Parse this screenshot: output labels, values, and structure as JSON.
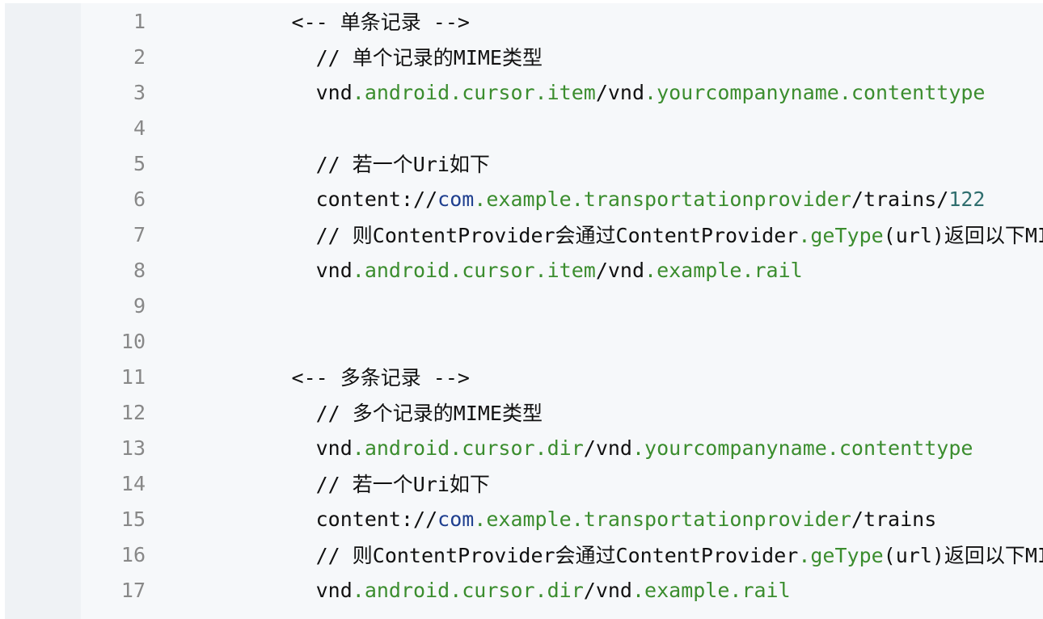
{
  "colors": {
    "background": "#f6f8fa",
    "gutter": "#eff2f5",
    "line_number": "#888888",
    "plain": "#111111",
    "property": "#3b8d2e",
    "keyword": "#1f3f8f",
    "number": "#2f6e6e"
  },
  "lines": [
    {
      "n": "1",
      "tokens": [
        {
          "t": "<-- 单条记录 -->",
          "c": "p"
        }
      ]
    },
    {
      "n": "2",
      "tokens": [
        {
          "t": "  // 单个记录的MIME类型",
          "c": "p"
        }
      ]
    },
    {
      "n": "3",
      "tokens": [
        {
          "t": "  vnd",
          "c": "p"
        },
        {
          "t": ".android.cursor.item",
          "c": "g"
        },
        {
          "t": "/vnd",
          "c": "p"
        },
        {
          "t": ".yourcompanyname.contenttype",
          "c": "g"
        }
      ]
    },
    {
      "n": "4",
      "tokens": []
    },
    {
      "n": "5",
      "tokens": [
        {
          "t": "  // 若一个Uri如下",
          "c": "p"
        }
      ]
    },
    {
      "n": "6",
      "tokens": [
        {
          "t": "  content://",
          "c": "p"
        },
        {
          "t": "com",
          "c": "b"
        },
        {
          "t": ".example.transportationprovider",
          "c": "g"
        },
        {
          "t": "/trains/",
          "c": "p"
        },
        {
          "t": "122",
          "c": "t"
        }
      ]
    },
    {
      "n": "7",
      "tokens": [
        {
          "t": "  // 则ContentProvider会通过ContentProvider",
          "c": "p"
        },
        {
          "t": ".geType",
          "c": "g"
        },
        {
          "t": "(url)返回以下MIME类型",
          "c": "p"
        }
      ]
    },
    {
      "n": "8",
      "tokens": [
        {
          "t": "  vnd",
          "c": "p"
        },
        {
          "t": ".android.cursor.item",
          "c": "g"
        },
        {
          "t": "/vnd",
          "c": "p"
        },
        {
          "t": ".example.rail",
          "c": "g"
        }
      ]
    },
    {
      "n": "9",
      "tokens": []
    },
    {
      "n": "10",
      "tokens": []
    },
    {
      "n": "11",
      "tokens": [
        {
          "t": "<-- 多条记录 -->",
          "c": "p"
        }
      ]
    },
    {
      "n": "12",
      "tokens": [
        {
          "t": "  // 多个记录的MIME类型",
          "c": "p"
        }
      ]
    },
    {
      "n": "13",
      "tokens": [
        {
          "t": "  vnd",
          "c": "p"
        },
        {
          "t": ".android.cursor.dir",
          "c": "g"
        },
        {
          "t": "/vnd",
          "c": "p"
        },
        {
          "t": ".yourcompanyname.contenttype",
          "c": "g"
        }
      ]
    },
    {
      "n": "14",
      "tokens": [
        {
          "t": "  // 若一个Uri如下",
          "c": "p"
        }
      ]
    },
    {
      "n": "15",
      "tokens": [
        {
          "t": "  content://",
          "c": "p"
        },
        {
          "t": "com",
          "c": "b"
        },
        {
          "t": ".example.transportationprovider",
          "c": "g"
        },
        {
          "t": "/trains",
          "c": "p"
        }
      ]
    },
    {
      "n": "16",
      "tokens": [
        {
          "t": "  // 则ContentProvider会通过ContentProvider",
          "c": "p"
        },
        {
          "t": ".geType",
          "c": "g"
        },
        {
          "t": "(url)返回以下MIME类型",
          "c": "p"
        }
      ]
    },
    {
      "n": "17",
      "tokens": [
        {
          "t": "  vnd",
          "c": "p"
        },
        {
          "t": ".android.cursor.dir",
          "c": "g"
        },
        {
          "t": "/vnd",
          "c": "p"
        },
        {
          "t": ".example.rail",
          "c": "g"
        }
      ]
    }
  ]
}
